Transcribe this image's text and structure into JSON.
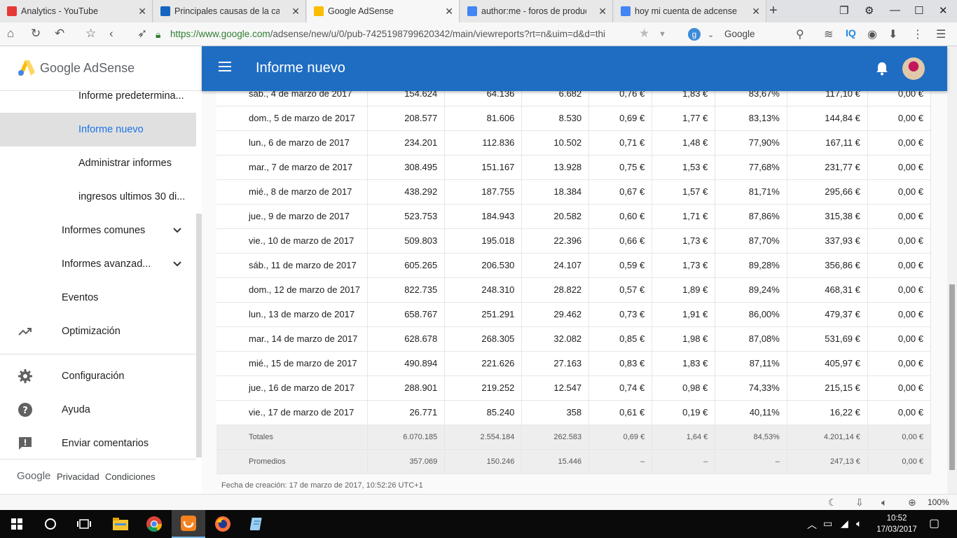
{
  "browser": {
    "tabs": [
      {
        "label": "Analytics - YouTube",
        "color": "#e53935"
      },
      {
        "label": "Principales causas de la caída d",
        "color": "#1565c0"
      },
      {
        "label": "Google AdSense",
        "color": "#fbbc04"
      },
      {
        "label": "author:me - foros de productos",
        "color": "#4285f4"
      },
      {
        "label": "hoy mi cuenta de adcense me",
        "color": "#4285f4"
      }
    ],
    "url_host": "https://www.google.com",
    "url_path": "/adsense/new/u/0/pub-7425198799620342/main/viewreports?rt=n&uim=d&d=thi",
    "search_engine": "Google",
    "search_badge": "g",
    "toolbar_text_iq": "IQ",
    "zoom": "100%"
  },
  "app": {
    "logo_text": "Google AdSense",
    "title": "Informe nuevo",
    "brand_color": "#1f6dc2"
  },
  "sidebar": {
    "items": [
      {
        "label": "Informe predetermina...",
        "active": false
      },
      {
        "label": "Informe nuevo",
        "active": true
      },
      {
        "label": "Administrar informes",
        "active": false
      },
      {
        "label": "ingresos ultimos 30 di...",
        "active": false
      },
      {
        "label": "Informes comunes",
        "expandable": true
      },
      {
        "label": "Informes avanzad...",
        "expandable": true
      },
      {
        "label": "Eventos"
      },
      {
        "label": "Optimización",
        "icon": "trending-up-icon"
      },
      {
        "label": "Configuración",
        "icon": "gear-icon"
      },
      {
        "label": "Ayuda",
        "icon": "help-icon"
      },
      {
        "label": "Enviar comentarios",
        "icon": "feedback-icon"
      }
    ],
    "footer": {
      "google": "Google",
      "privacy": "Privacidad",
      "terms": "Condiciones"
    }
  },
  "report": {
    "rows": [
      [
        "sáb., 4 de marzo de 2017",
        "154.624",
        "64.136",
        "6.682",
        "0,76 €",
        "1,83 €",
        "83,67%",
        "117,10 €",
        "0,00 €"
      ],
      [
        "dom., 5 de marzo de 2017",
        "208.577",
        "81.606",
        "8.530",
        "0,69 €",
        "1,77 €",
        "83,13%",
        "144,84 €",
        "0,00 €"
      ],
      [
        "lun., 6 de marzo de 2017",
        "234.201",
        "112.836",
        "10.502",
        "0,71 €",
        "1,48 €",
        "77,90%",
        "167,11 €",
        "0,00 €"
      ],
      [
        "mar., 7 de marzo de 2017",
        "308.495",
        "151.167",
        "13.928",
        "0,75 €",
        "1,53 €",
        "77,68%",
        "231,77 €",
        "0,00 €"
      ],
      [
        "mié., 8 de marzo de 2017",
        "438.292",
        "187.755",
        "18.384",
        "0,67 €",
        "1,57 €",
        "81,71%",
        "295,66 €",
        "0,00 €"
      ],
      [
        "jue., 9 de marzo de 2017",
        "523.753",
        "184.943",
        "20.582",
        "0,60 €",
        "1,71 €",
        "87,86%",
        "315,38 €",
        "0,00 €"
      ],
      [
        "vie., 10 de marzo de 2017",
        "509.803",
        "195.018",
        "22.396",
        "0,66 €",
        "1,73 €",
        "87,70%",
        "337,93 €",
        "0,00 €"
      ],
      [
        "sáb., 11 de marzo de 2017",
        "605.265",
        "206.530",
        "24.107",
        "0,59 €",
        "1,73 €",
        "89,28%",
        "356,86 €",
        "0,00 €"
      ],
      [
        "dom., 12 de marzo de 2017",
        "822.735",
        "248.310",
        "28.822",
        "0,57 €",
        "1,89 €",
        "89,24%",
        "468,31 €",
        "0,00 €"
      ],
      [
        "lun., 13 de marzo de 2017",
        "658.767",
        "251.291",
        "29.462",
        "0,73 €",
        "1,91 €",
        "86,00%",
        "479,37 €",
        "0,00 €"
      ],
      [
        "mar., 14 de marzo de 2017",
        "628.678",
        "268.305",
        "32.082",
        "0,85 €",
        "1,98 €",
        "87,08%",
        "531,69 €",
        "0,00 €"
      ],
      [
        "mié., 15 de marzo de 2017",
        "490.894",
        "221.626",
        "27.163",
        "0,83 €",
        "1,83 €",
        "87,11%",
        "405,97 €",
        "0,00 €"
      ],
      [
        "jue., 16 de marzo de 2017",
        "288.901",
        "219.252",
        "12.547",
        "0,74 €",
        "0,98 €",
        "74,33%",
        "215,15 €",
        "0,00 €"
      ],
      [
        "vie., 17 de marzo de 2017",
        "26.771",
        "85.240",
        "358",
        "0,61 €",
        "0,19 €",
        "40,11%",
        "16,22 €",
        "0,00 €"
      ]
    ],
    "totals": [
      "Totales",
      "6.070.185",
      "2.554.184",
      "262.583",
      "0,69 €",
      "1,64 €",
      "84,53%",
      "4.201,14 €",
      "0,00 €"
    ],
    "averages": [
      "Promedios",
      "357.069",
      "150.246",
      "15.446",
      "–",
      "–",
      "–",
      "247,13 €",
      "0,00 €"
    ],
    "created": "Fecha de creación: 17 de marzo de 2017, 10:52:26 UTC+1"
  },
  "taskbar": {
    "time": "10:52",
    "date": "17/03/2017"
  }
}
